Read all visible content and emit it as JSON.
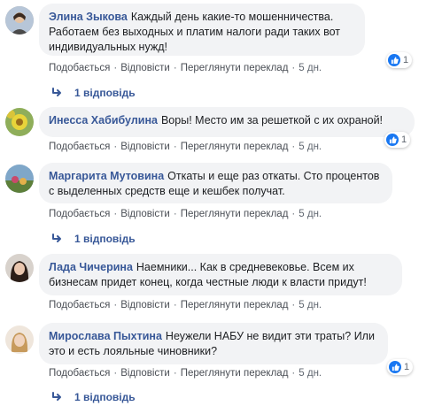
{
  "actions": {
    "like": "Подобається",
    "reply": "Відповісти",
    "translate": "Переглянути переклад",
    "separator": "·"
  },
  "comments": [
    {
      "author": "Элина Зыкова",
      "text_lines": [
        "Каждый день какие-то мошенничества.",
        "Работаем без выходных и платим налоги ради таких вот",
        "индивидуальных нужд!"
      ],
      "time": "5 дн.",
      "reactions": "1",
      "replies": "1 відповідь"
    },
    {
      "author": "Инесса Хабибулина",
      "text_lines": [
        "Воры! Место им за решеткой с их охраной!"
      ],
      "time": "5 дн.",
      "reactions": "1",
      "replies": null
    },
    {
      "author": "Маргарита Мутовина",
      "text_lines": [
        "Откаты и еще раз откаты. Сто процентов",
        "с выделенных средств еще и кешбек получат."
      ],
      "time": "5 дн.",
      "reactions": null,
      "replies": "1 відповідь"
    },
    {
      "author": "Лада Чичерина",
      "text_lines": [
        "Наемники... Как в средневековье. Всем их",
        "бизнесам придет конец, когда честные люди к власти придут!"
      ],
      "time": "5 дн.",
      "reactions": null,
      "replies": null
    },
    {
      "author": "Мирослава Пыхтина",
      "text_lines": [
        "Неужели НАБУ не видит эти траты? Или",
        "это и есть лояльные чиновники?"
      ],
      "time": "5 дн.",
      "reactions": "1",
      "replies": "1 відповідь"
    }
  ],
  "colors": {
    "author": "#385898",
    "bubble": "#f2f3f5",
    "like_blue": "#1877f2"
  }
}
